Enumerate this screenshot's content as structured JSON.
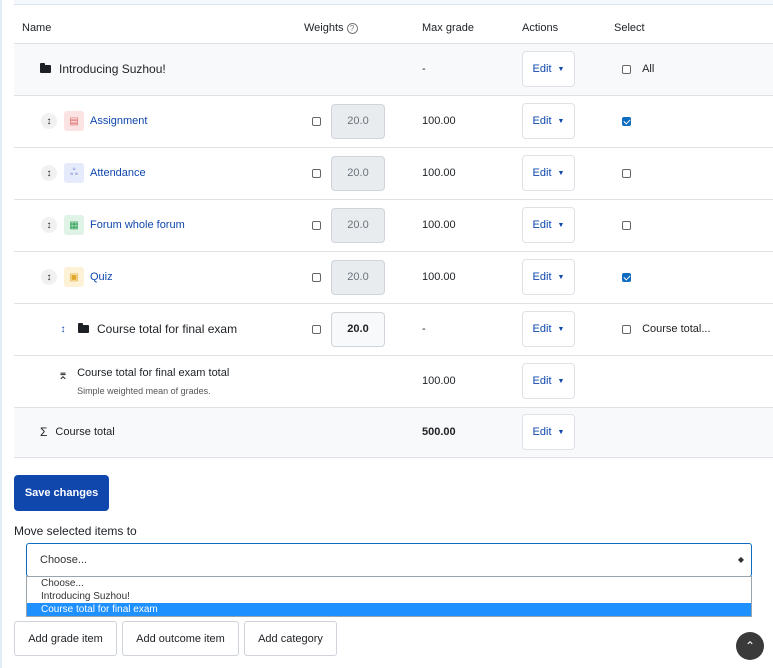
{
  "table": {
    "headers": {
      "name": "Name",
      "weights": "Weights",
      "max_grade": "Max grade",
      "actions": "Actions",
      "select": "Select"
    },
    "category": {
      "title": "Introducing Suzhou!",
      "max": "-",
      "edit": "Edit",
      "select_all": "All"
    },
    "items": [
      {
        "name": "Assignment",
        "icon": "assignment-icon",
        "weight": "20.0",
        "max": "100.00",
        "edit": "Edit",
        "weight_checked": false,
        "selected": true
      },
      {
        "name": "Attendance",
        "icon": "attendance-icon",
        "weight": "20.0",
        "max": "100.00",
        "edit": "Edit",
        "weight_checked": false,
        "selected": false
      },
      {
        "name": "Forum whole forum",
        "icon": "forum-icon",
        "weight": "20.0",
        "max": "100.00",
        "edit": "Edit",
        "weight_checked": false,
        "selected": false
      },
      {
        "name": "Quiz",
        "icon": "quiz-icon",
        "weight": "20.0",
        "max": "100.00",
        "edit": "Edit",
        "weight_checked": false,
        "selected": true
      }
    ],
    "subcategory": {
      "title": "Course total for final exam",
      "weight": "20.0",
      "max": "-",
      "edit": "Edit",
      "select_label": "Course total..."
    },
    "subtotal": {
      "title": "Course total for final exam total",
      "description": "Simple weighted mean of grades.",
      "max": "100.00",
      "edit": "Edit"
    },
    "total": {
      "title": "Course total",
      "max": "500.00",
      "edit": "Edit"
    }
  },
  "save_button": "Save changes",
  "move": {
    "label": "Move selected items to",
    "selected": "Choose...",
    "options": [
      "Choose...",
      "Introducing Suzhou!",
      "Course total for final exam"
    ],
    "highlighted_option": "Course total for final exam"
  },
  "bottom_buttons": {
    "add_grade_item": "Add grade item",
    "add_outcome_item": "Add outcome item",
    "add_category": "Add category"
  },
  "colors": {
    "primary": "#0f47ad",
    "checkbox": "#0f6cbf",
    "highlight": "#1e90ff"
  }
}
